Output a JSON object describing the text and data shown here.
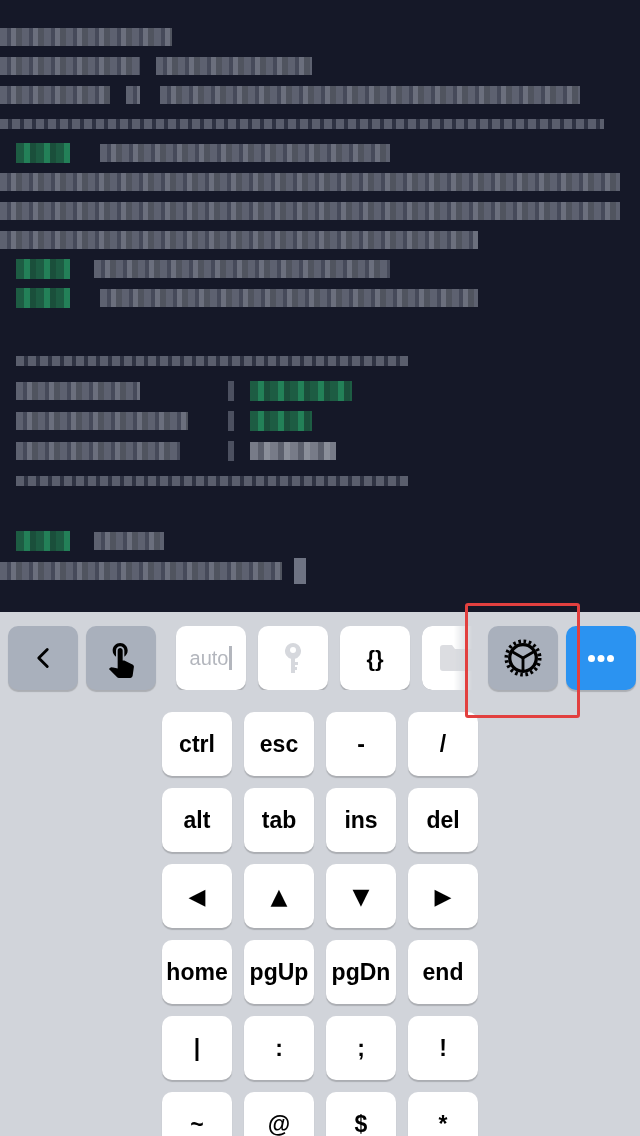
{
  "toolbar": {
    "back_button": {
      "disabled": false
    },
    "touch_button": {
      "disabled": false
    },
    "auto_button": {
      "label": "auto",
      "disabled": true
    },
    "key_button": {
      "disabled": true
    },
    "braces_button": {
      "label": "{}",
      "disabled": false
    },
    "folder_button": {
      "disabled": true
    },
    "settings_button": {
      "disabled": false,
      "highlighted": true
    },
    "more_button": {
      "disabled": false
    }
  },
  "keys": [
    [
      "ctrl",
      "esc",
      "-",
      "/"
    ],
    [
      "alt",
      "tab",
      "ins",
      "del"
    ],
    [
      "◀",
      "▲",
      "▼",
      "▶"
    ],
    [
      "home",
      "pgUp",
      "pgDn",
      "end"
    ],
    [
      "|",
      ":",
      ";",
      "!"
    ],
    [
      "~",
      "@",
      "$",
      "*"
    ]
  ]
}
